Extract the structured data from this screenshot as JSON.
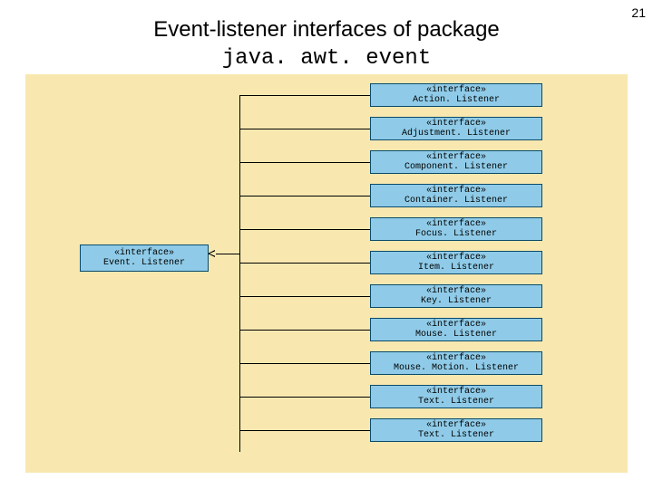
{
  "page_number": "21",
  "title_line1": "Event-listener interfaces of package",
  "title_line2": "java. awt. event",
  "stereotype": "«interface»",
  "root": "Event. Listener",
  "children": [
    "Action. Listener",
    "Adjustment. Listener",
    "Component. Listener",
    "Container. Listener",
    "Focus. Listener",
    "Item. Listener",
    "Key. Listener",
    "Mouse. Listener",
    "Mouse. Motion. Listener",
    "Text. Listener",
    "Text. Listener"
  ]
}
